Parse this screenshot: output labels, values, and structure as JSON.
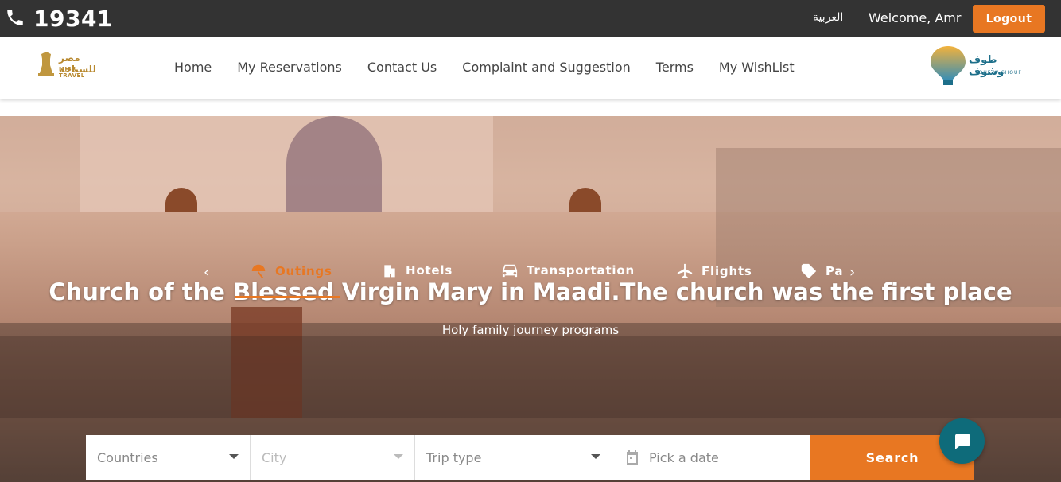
{
  "topbar": {
    "phone_number": "19341",
    "language_link": "العربية",
    "welcome_text": "Welcome, Amr",
    "logout_label": "Logout"
  },
  "navbar": {
    "left_logo": {
      "arabic": "مصر للسياحة",
      "english": "MISR TRAVEL"
    },
    "links": [
      "Home",
      "My Reservations",
      "Contact Us",
      "Complaint and Suggestion",
      "Terms",
      "My WishList"
    ],
    "right_logo": {
      "arabic": "طوف وشوف",
      "english": "TOUF W SHOUF"
    }
  },
  "hero": {
    "title": "Church of the Blessed Virgin Mary in Maadi.The church was the first place",
    "subtitle": "Holy family journey programs",
    "tabs": [
      {
        "label": "Outings",
        "icon": "umbrella-icon",
        "active": true
      },
      {
        "label": "Hotels",
        "icon": "building-icon",
        "active": false
      },
      {
        "label": "Transportation",
        "icon": "car-icon",
        "active": false
      },
      {
        "label": "Flights",
        "icon": "plane-icon",
        "active": false
      },
      {
        "label": "Pa",
        "icon": "tag-icon",
        "active": false
      }
    ]
  },
  "search": {
    "countries_placeholder": "Countries",
    "city_placeholder": "City",
    "trip_type_placeholder": "Trip type",
    "date_placeholder": "Pick a date",
    "search_label": "Search"
  },
  "colors": {
    "accent": "#e87722",
    "topbar": "#333333",
    "chat": "#0e6b7a"
  }
}
